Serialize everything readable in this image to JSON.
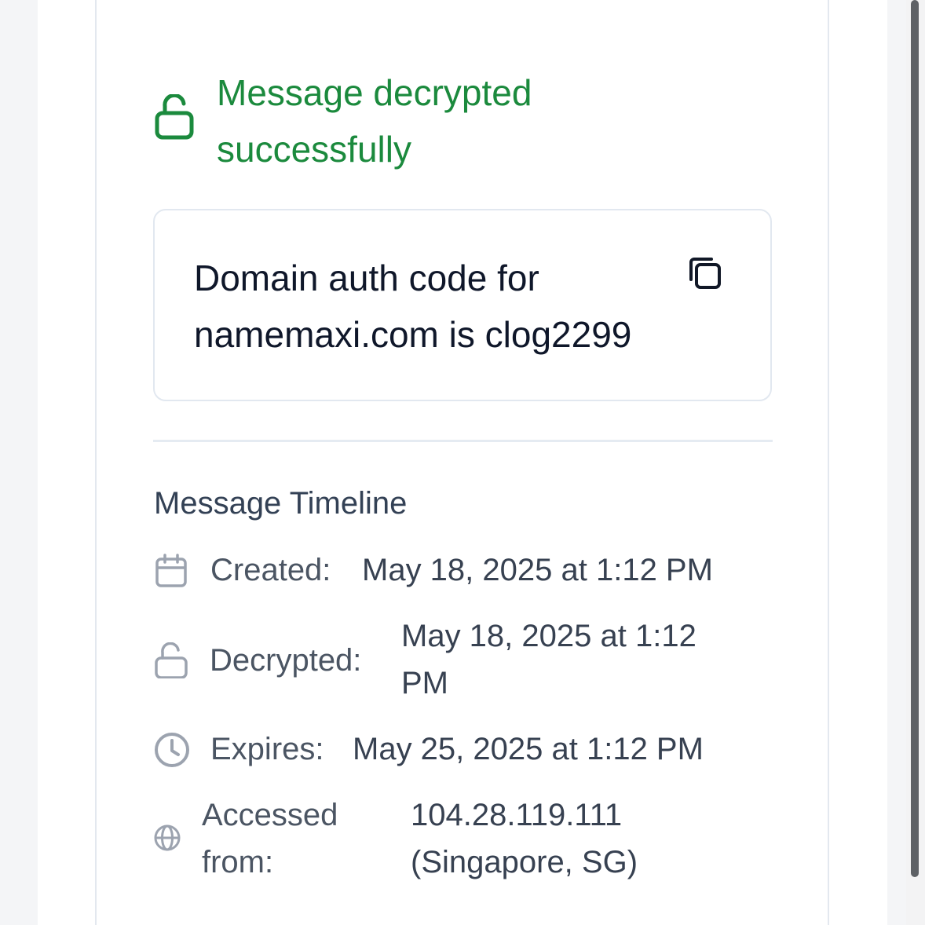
{
  "status": {
    "message": "Message decrypted successfully",
    "color": "#1b8a3d",
    "icon": "unlocked-lock-icon"
  },
  "message": {
    "text": "Domain auth code for namemaxi.com is clog2299",
    "copy_icon": "copy-icon"
  },
  "timeline": {
    "title": "Message Timeline",
    "rows": [
      {
        "icon": "calendar-icon",
        "label": "Created:",
        "value": "May 18, 2025 at 1:12 PM"
      },
      {
        "icon": "unlocked-lock-icon",
        "label": "Decrypted:",
        "value": "May 18, 2025 at 1:12 PM"
      },
      {
        "icon": "clock-icon",
        "label": "Expires:",
        "value": "May 25, 2025 at 1:12 PM"
      },
      {
        "icon": "globe-icon",
        "label": "Accessed from:",
        "value": "104.28.119.111 (Singapore, SG)"
      }
    ]
  },
  "colors": {
    "success": "#1b8a3d",
    "text_dark": "#0f172a",
    "text_muted": "#4b5563",
    "border": "#e2e8f0"
  }
}
